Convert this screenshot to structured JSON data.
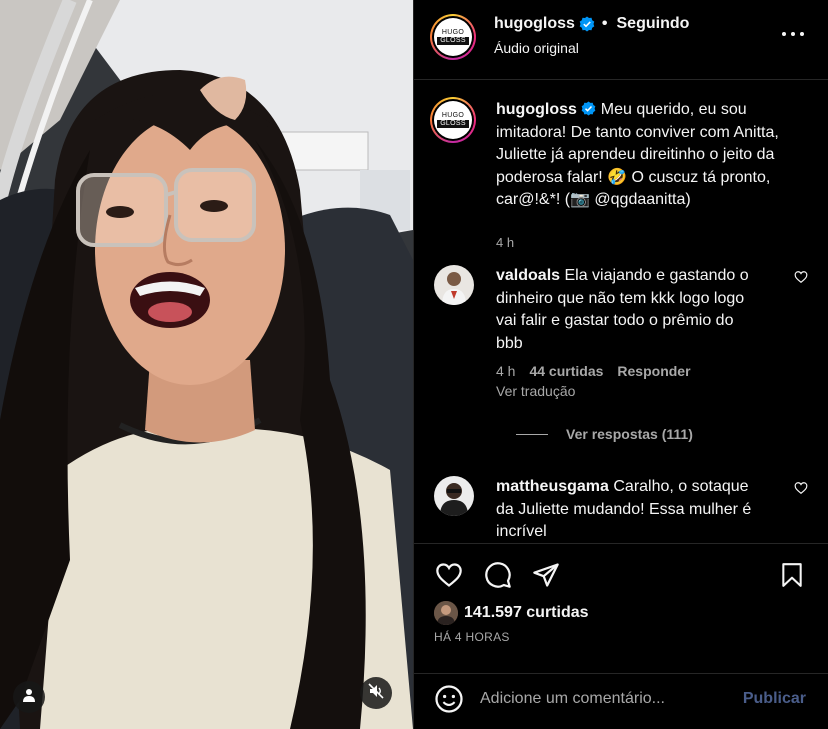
{
  "colors": {
    "accent": "#0095f6",
    "muted": "#a8a8a8",
    "publish_disabled": "#4a5d8a",
    "background": "#000000"
  },
  "media": {
    "tag_icon": "user-tag-icon",
    "mute_icon": "speaker-muted-icon"
  },
  "header": {
    "logo_top": "HUGO",
    "logo_bottom": "GLOSS",
    "username": "hugogloss",
    "verified_icon": "verified-badge-icon",
    "separator": "•",
    "follow_status": "Seguindo",
    "subtitle": "Áudio original",
    "more_icon": "more-options-icon"
  },
  "caption": {
    "username": "hugogloss",
    "text": "Meu querido, eu sou imitadora! De tanto conviver com Anitta, Juliette já aprendeu direitinho o jeito da poderosa falar! 🤣 O cuscuz tá pronto, car@!&*! (📷 @qgdaanitta)",
    "time": "4 h"
  },
  "comments": [
    {
      "username": "valdoals",
      "text": "Ela viajando e gastando o dinheiro que não tem kkk logo logo vai falir e gastar todo o prêmio do bbb",
      "time": "4 h",
      "likes": "44 curtidas",
      "reply": "Responder",
      "translate": "Ver tradução",
      "view_replies": "Ver respostas (111)"
    },
    {
      "username": "mattheusgama",
      "text": "Caralho, o sotaque da Juliette mudando! Essa mulher é incrível"
    }
  ],
  "actions": {
    "like_icon": "heart-icon",
    "comment_icon": "comment-icon",
    "share_icon": "share-icon",
    "save_icon": "bookmark-icon",
    "likes_count": "141.597 curtidas",
    "time_ago": "HÁ 4 HORAS"
  },
  "add_comment": {
    "emoji_icon": "emoji-icon",
    "placeholder": "Adicione um comentário...",
    "publish_label": "Publicar"
  }
}
